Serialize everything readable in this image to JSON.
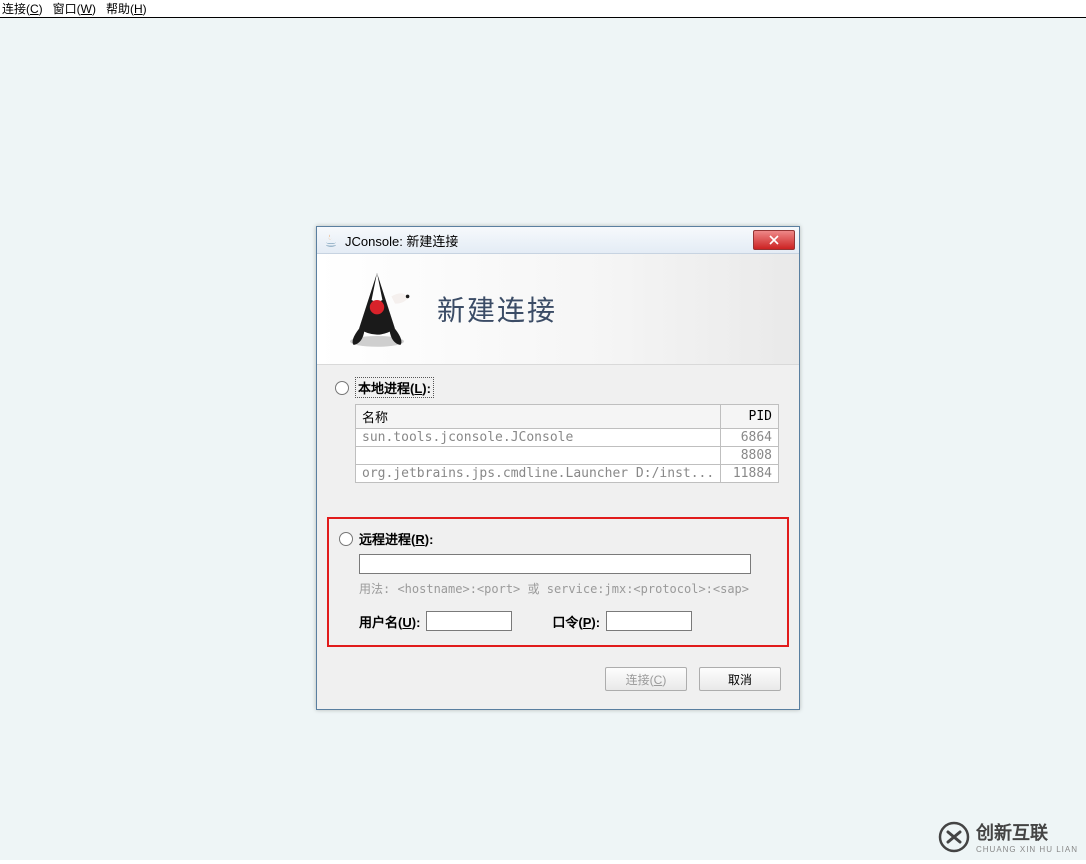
{
  "menu": {
    "connect": "连接(C)",
    "window": "窗口(W)",
    "help": "帮助(H)"
  },
  "dialog": {
    "title": "JConsole: 新建连接",
    "heading": "新建连接"
  },
  "local": {
    "label": "本地进程(L):",
    "columns": {
      "name": "名称",
      "pid": "PID"
    },
    "rows": [
      {
        "name": "sun.tools.jconsole.JConsole",
        "pid": "6864"
      },
      {
        "name": "",
        "pid": "8808"
      },
      {
        "name": "org.jetbrains.jps.cmdline.Launcher D:/inst...",
        "pid": "11884"
      }
    ]
  },
  "remote": {
    "label": "远程进程(R):",
    "usage_prefix": "用法: ",
    "usage": "<hostname>:<port> 或 service:jmx:<protocol>:<sap>",
    "username_label": "用户名(U):",
    "password_label": "口令(P):"
  },
  "buttons": {
    "connect": "连接(C)",
    "cancel": "取消"
  },
  "brand": {
    "name": "创新互联",
    "sub": "CHUANG XIN HU LIAN"
  }
}
